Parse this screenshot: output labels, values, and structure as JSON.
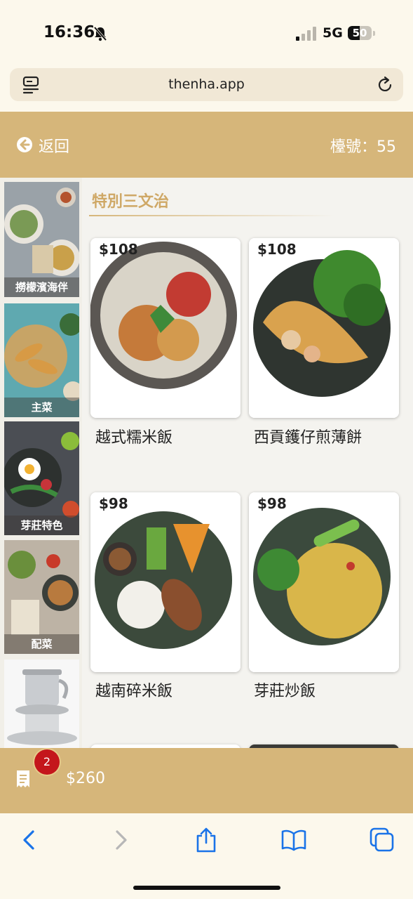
{
  "status": {
    "time": "16:36",
    "network": "5G",
    "battery": "50",
    "battery_level": 0.5
  },
  "browser": {
    "url": "thenha.app"
  },
  "header": {
    "back_label": "返回",
    "table_label": "檯號：55"
  },
  "sidebar": {
    "items": [
      {
        "label": "撈檬濱海伴"
      },
      {
        "label": "主菜"
      },
      {
        "label": "芽莊特色"
      },
      {
        "label": "配菜"
      },
      {
        "label": ""
      }
    ]
  },
  "section": {
    "title": "特別三文治"
  },
  "dishes": [
    {
      "price": "$108",
      "name": "越式糯米飯"
    },
    {
      "price": "$108",
      "name": "西貢鑊仔煎薄餅"
    },
    {
      "price": "$98",
      "name": "越南碎米飯"
    },
    {
      "price": "$98",
      "name": "芽莊炒飯"
    }
  ],
  "cart": {
    "count": "2",
    "total": "$260"
  },
  "colors": {
    "accent": "#d6b67a",
    "badge": "#c4161c",
    "link": "#1a73e8"
  },
  "icons": [
    "muted-bell-icon",
    "signal-icon",
    "battery-icon",
    "menu-icon",
    "reload-icon",
    "back-arrow-icon",
    "receipt-icon",
    "chevron-left-icon",
    "chevron-right-icon",
    "share-icon",
    "bookmarks-icon",
    "tabs-icon"
  ]
}
